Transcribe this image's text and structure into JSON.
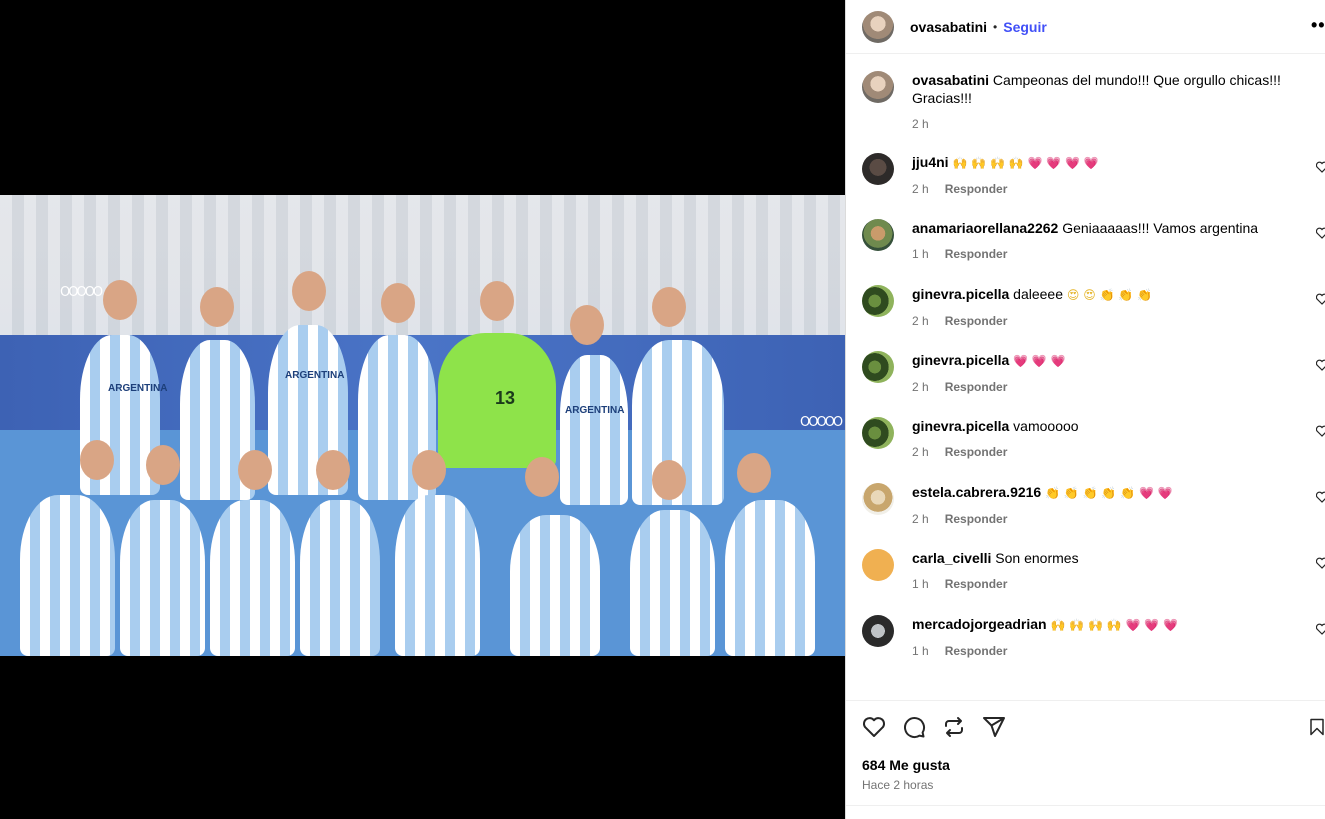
{
  "post": {
    "author": "ovasabatini",
    "separator": "•",
    "follow_label": "Seguir",
    "more_icon": "more-horizontal-icon",
    "caption": "Campeonas del mundo!!! Que orgullo chicas!!! Gracias!!!",
    "caption_time": "2 h"
  },
  "comments": [
    {
      "user": "jju4ni",
      "text": "",
      "emoji_gold": "🙌 🙌 🙌 🙌",
      "emoji_red": "💗 💗 💗 💗",
      "time": "2 h",
      "reply": "Responder"
    },
    {
      "user": "anamariaorellana2262",
      "text": "Geniaaaaas!!! Vamos argentina",
      "emoji_gold": "",
      "emoji_red": "",
      "time": "1 h",
      "reply": "Responder"
    },
    {
      "user": "ginevra.picella",
      "text": "daleeee",
      "emoji_gold": "😍 😍 👏 👏 👏",
      "emoji_red": "",
      "time": "2 h",
      "reply": "Responder"
    },
    {
      "user": "ginevra.picella",
      "text": "",
      "emoji_gold": "",
      "emoji_red": "💗 💗 💗",
      "time": "2 h",
      "reply": "Responder"
    },
    {
      "user": "ginevra.picella",
      "text": "vamooooo",
      "emoji_gold": "",
      "emoji_red": "",
      "time": "2 h",
      "reply": "Responder"
    },
    {
      "user": "estela.cabrera.9216",
      "text": "",
      "emoji_gold": "👏 👏 👏 👏 👏",
      "emoji_red": "💗 💗",
      "time": "2 h",
      "reply": "Responder"
    },
    {
      "user": "carla_civelli",
      "text": "Son enormes",
      "emoji_gold": "",
      "emoji_red": "",
      "time": "1 h",
      "reply": "Responder"
    },
    {
      "user": "mercadojorgeadrian",
      "text": "",
      "emoji_gold": "🙌 🙌 🙌 🙌",
      "emoji_red": "💗 💗 💗",
      "time": "1 h",
      "reply": "Responder"
    }
  ],
  "footer": {
    "likes": "684 Me gusta",
    "timestamp": "Hace 2 horas"
  },
  "photo": {
    "jersey_text": "ARGENTINA",
    "keeper_number": "13",
    "rings": "OOOOO"
  },
  "colors": {
    "follow": "#4150f7",
    "muted": "#737373",
    "heart": "#e0245e"
  }
}
